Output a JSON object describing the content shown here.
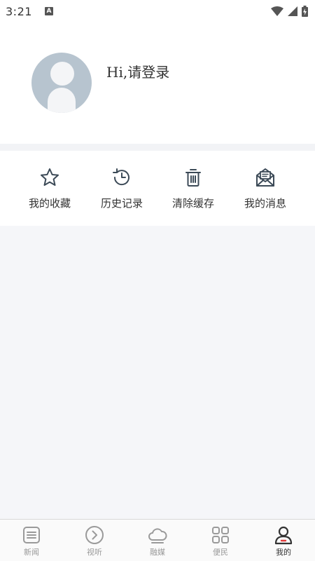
{
  "status_bar": {
    "time": "3:21",
    "icons": [
      "notification-a-icon",
      "wifi-icon",
      "signal-icon",
      "battery-charging-icon"
    ]
  },
  "profile": {
    "greeting": "Hi,请登录",
    "avatar_icon": "default-avatar-icon"
  },
  "actions": [
    {
      "label": "我的收藏",
      "icon": "star-icon"
    },
    {
      "label": "历史记录",
      "icon": "history-clock-icon"
    },
    {
      "label": "清除缓存",
      "icon": "trash-icon"
    },
    {
      "label": "我的消息",
      "icon": "mail-icon"
    }
  ],
  "bottom_nav": {
    "items": [
      {
        "label": "新闻",
        "icon": "news-icon",
        "active": false
      },
      {
        "label": "视听",
        "icon": "play-circle-icon",
        "active": false
      },
      {
        "label": "融媒",
        "icon": "cloud-icon",
        "active": false
      },
      {
        "label": "便民",
        "icon": "grid-icon",
        "active": false
      },
      {
        "label": "我的",
        "icon": "user-icon",
        "active": true
      }
    ]
  },
  "colors": {
    "icon": "#3c4a57",
    "inactive_nav": "#9a9a9a",
    "active_accent": "#e23b3b",
    "avatar_bg": "#b7c4cf"
  }
}
